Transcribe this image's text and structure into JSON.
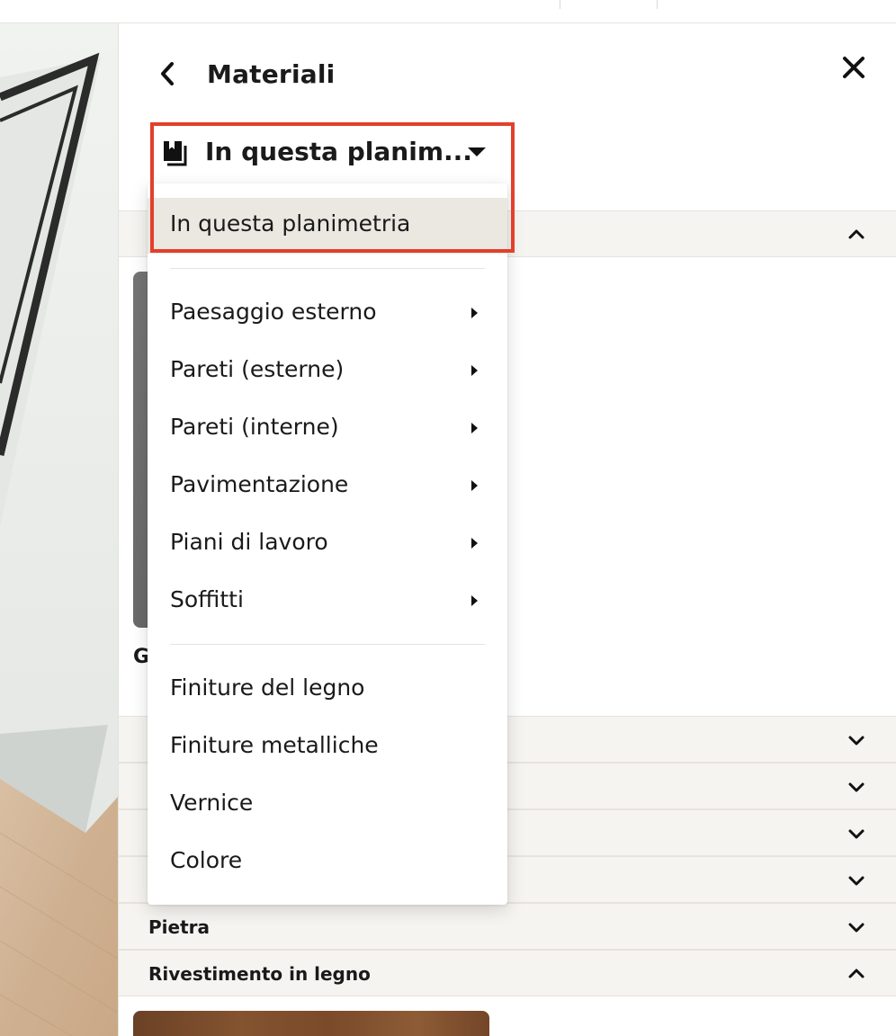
{
  "panel": {
    "title": "Materiali"
  },
  "dropdown": {
    "selected_value": "In questa planim...",
    "options_top": [
      {
        "label": "In questa planimetria",
        "selected": true
      }
    ],
    "options_categories": [
      {
        "label": "Paesaggio esterno",
        "has_submenu": true
      },
      {
        "label": "Pareti (esterne)",
        "has_submenu": true
      },
      {
        "label": "Pareti (interne)",
        "has_submenu": true
      },
      {
        "label": "Pavimentazione",
        "has_submenu": true
      },
      {
        "label": "Piani di lavoro",
        "has_submenu": true
      },
      {
        "label": "Soffitti",
        "has_submenu": true
      }
    ],
    "options_finishes": [
      {
        "label": "Finiture del legno"
      },
      {
        "label": "Finiture metalliche"
      },
      {
        "label": "Vernice"
      },
      {
        "label": "Colore"
      }
    ]
  },
  "partial_sample_letter": "G",
  "sections": [
    {
      "label": "",
      "state": "expanded"
    },
    {
      "label": "",
      "state": "collapsed"
    },
    {
      "label": "",
      "state": "collapsed"
    },
    {
      "label": "",
      "state": "collapsed"
    },
    {
      "label": "",
      "state": "collapsed"
    },
    {
      "label": "Pietra",
      "state": "collapsed"
    },
    {
      "label": "Rivestimento in legno",
      "state": "expanded"
    }
  ],
  "colors": {
    "highlight": "#e2402a",
    "selected_bg": "#ebe8e2",
    "section_bg": "#f6f4f0"
  }
}
